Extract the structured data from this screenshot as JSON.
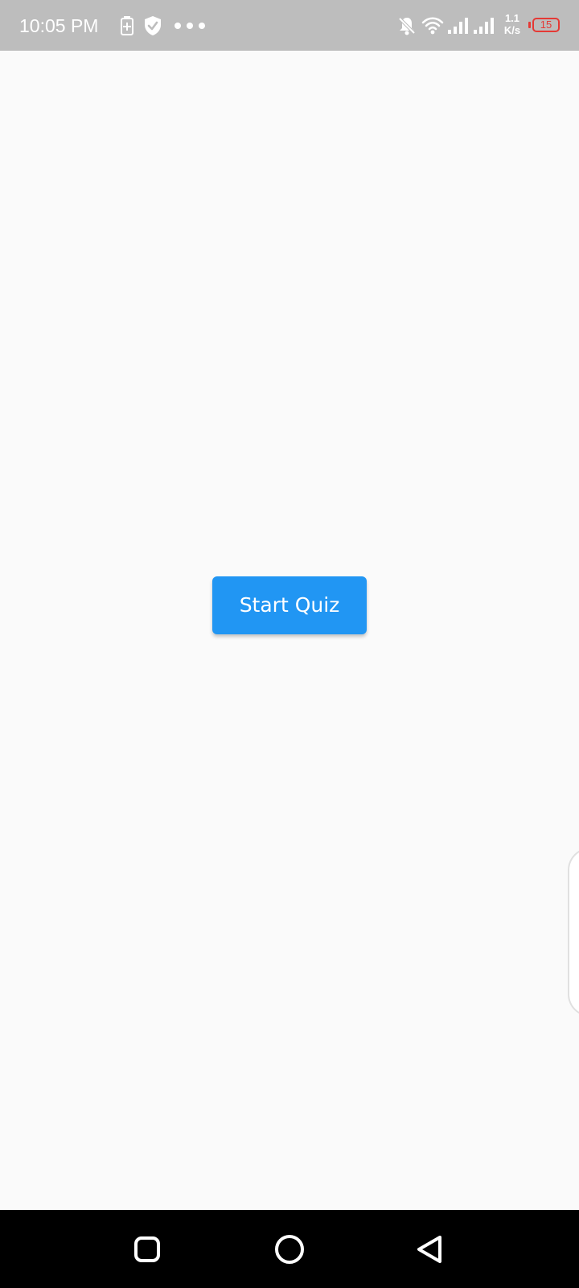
{
  "status_bar": {
    "time": "10:05 PM",
    "net_speed_value": "1.1",
    "net_speed_unit": "K/s",
    "battery_level": "15",
    "icons": [
      "battery-saver-icon",
      "shield-check-icon",
      "more-notifications-icon",
      "notifications-off-icon",
      "wifi-icon",
      "signal-icon",
      "signal-icon",
      "battery-icon"
    ]
  },
  "main": {
    "start_button_label": "Start Quiz"
  },
  "nav_bar": {
    "buttons": [
      "recents-button",
      "home-button",
      "back-button"
    ]
  },
  "colors": {
    "status_bar_bg": "#bdbdbd",
    "page_bg": "#fafafa",
    "accent": "#2196f3",
    "battery_low": "#e53935",
    "nav_bar_bg": "#000000"
  }
}
